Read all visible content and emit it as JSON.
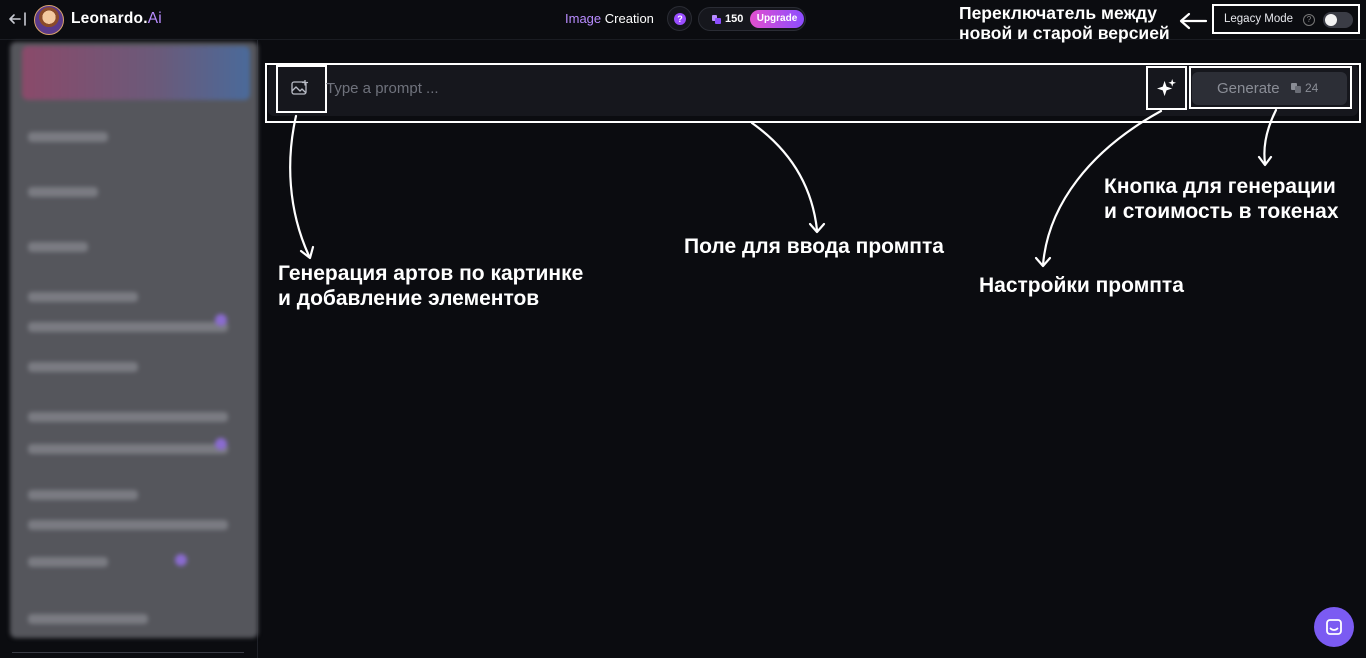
{
  "header": {
    "app_name": "Leonardo.",
    "app_name_suffix": "Ai",
    "mode_prefix": "Image",
    "mode_title": "Creation",
    "help_glyph": "?",
    "token_count": "150",
    "upgrade_label": "Upgrade",
    "legacy_label": "Legacy Mode",
    "legacy_help_glyph": "?",
    "legacy_enabled": false
  },
  "prompt": {
    "placeholder": "Type a prompt ...",
    "value": "",
    "generate_label": "Generate",
    "generate_cost": "24"
  },
  "annotations": {
    "legacy_line1": "Переключатель между",
    "legacy_line2": "новой и старой версией",
    "image_line1": "Генерация артов по картинке",
    "image_line2": "и добавление элементов",
    "prompt_field": "Поле для ввода промпта",
    "settings": "Настройки промпта",
    "generate_line1": "Кнопка для генерации",
    "generate_line2": "и стоимость в токенах"
  },
  "colors": {
    "background": "#0b0c10",
    "accent_purple": "#b88cff",
    "upgrade_gradient_start": "#e24fcf",
    "upgrade_gradient_end": "#8c4dff",
    "chat_button": "#7b5bf2"
  },
  "icons": {
    "back": "arrow-left-from-line-icon",
    "image_upload": "image-plus-icon",
    "prompt_settings": "sparkle-icon",
    "token": "token-coin-icon",
    "chat": "chat-bubble-icon"
  }
}
